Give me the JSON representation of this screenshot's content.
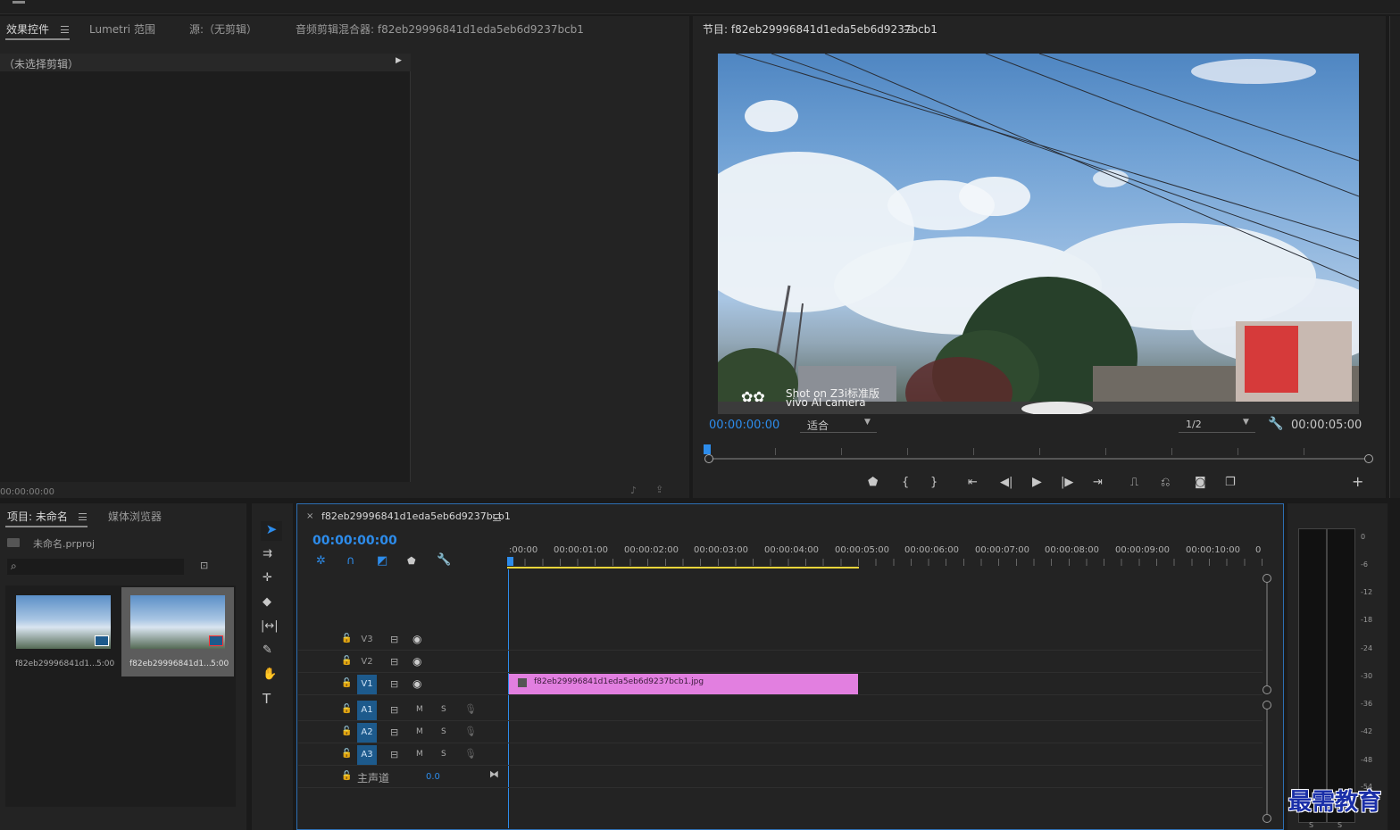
{
  "effects_panel": {
    "tabs": [
      "效果控件",
      "Lumetri 范围",
      "源:（无剪辑）",
      "音频剪辑混合器: f82eb29996841d1eda5eb6d9237bcb1"
    ],
    "no_clip": "（未选择剪辑）",
    "timecode": "00:00:00:00"
  },
  "program_monitor": {
    "title": "节目: f82eb29996841d1eda5eb6d9237bcb1",
    "timecode": "00:00:00:00",
    "fit": "适合",
    "resolution": "1/2",
    "duration": "00:00:05:00",
    "watermark_line1": "Shot on Z3i标准版",
    "watermark_line2": "vivo AI camera"
  },
  "project_panel": {
    "tabs": [
      "项目: 未命名",
      "媒体浏览器"
    ],
    "file": "未命名.prproj",
    "items": [
      {
        "name": "f82eb29996841d1...",
        "duration": "5:00"
      },
      {
        "name": "f82eb29996841d1...",
        "duration": "5:00"
      }
    ]
  },
  "timeline": {
    "tab": "f82eb29996841d1eda5eb6d9237bcb1",
    "close": "×",
    "timecode": "00:00:00:00",
    "ruler": [
      ":00:00",
      "00:00:01:00",
      "00:00:02:00",
      "00:00:03:00",
      "00:00:04:00",
      "00:00:05:00",
      "00:00:06:00",
      "00:00:07:00",
      "00:00:08:00",
      "00:00:09:00",
      "00:00:10:00",
      "0"
    ],
    "video_tracks": [
      "V3",
      "V2",
      "V1"
    ],
    "audio_tracks": [
      "A1",
      "A2",
      "A3"
    ],
    "m": "M",
    "s": "S",
    "master": "主声道",
    "master_value": "0.0",
    "clip_name": "f82eb29996841d1eda5eb6d9237bcb1.jpg"
  },
  "audio_meter": {
    "labels": [
      "0",
      "-6",
      "-12",
      "-18",
      "-24",
      "-30",
      "-36",
      "-42",
      "-48",
      "-54"
    ],
    "bottom": [
      "S",
      "S"
    ]
  },
  "logo_text": "最需教育",
  "colors": {
    "accent": "#2d8ceb",
    "clip": "#e27fe0",
    "track_on": "#1d5a8c",
    "work_area": "#e8d43a"
  }
}
